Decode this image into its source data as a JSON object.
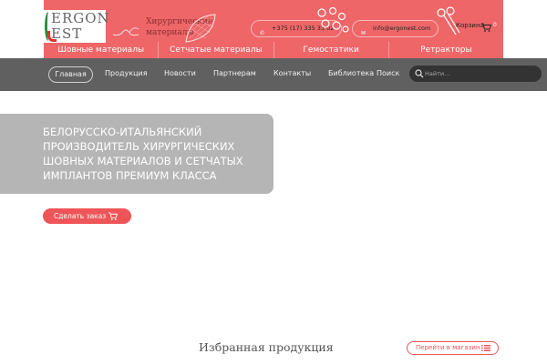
{
  "logo": {
    "line1": "ERGON",
    "line2": "EST"
  },
  "tagline": {
    "line1": "Хирургические",
    "line2": "материалы"
  },
  "contacts": {
    "phone": "+375 (17) 335 33 02",
    "email": "info@ergonest.com"
  },
  "cart": {
    "label": "Корзина",
    "count": "0"
  },
  "categories": [
    {
      "label": "Шовные материалы"
    },
    {
      "label": "Сетчатые материалы"
    },
    {
      "label": "Гемостатики"
    },
    {
      "label": "Ретракторы"
    }
  ],
  "nav": {
    "items": [
      {
        "label": "Главная"
      },
      {
        "label": "Продукция"
      },
      {
        "label": "Новости"
      },
      {
        "label": "Партнерам"
      },
      {
        "label": "Контакты"
      },
      {
        "label": "Библиотека"
      }
    ],
    "search_label": "Поиск",
    "search_placeholder": "Найти..."
  },
  "hero": {
    "lines": [
      "БЕЛОРУССКО-ИТАЛЬЯНСКИЙ",
      "ПРОИЗВОДИТЕЛЬ ХИРУРГИЧЕСКИХ",
      "ШОВНЫХ МАТЕРИАЛОВ И СЕТЧАТЫХ",
      "ИМПЛАНТОВ ПРЕМИУМ КЛАССА"
    ],
    "order_button": "Сделать заказ"
  },
  "featured": {
    "title": "Избранная продукция",
    "shop_button": "Перейти в магазин"
  },
  "colors": {
    "accent": "#ee5558",
    "header": "#ee6668",
    "nav": "#606060",
    "hero_box": "#b5b5b5"
  }
}
